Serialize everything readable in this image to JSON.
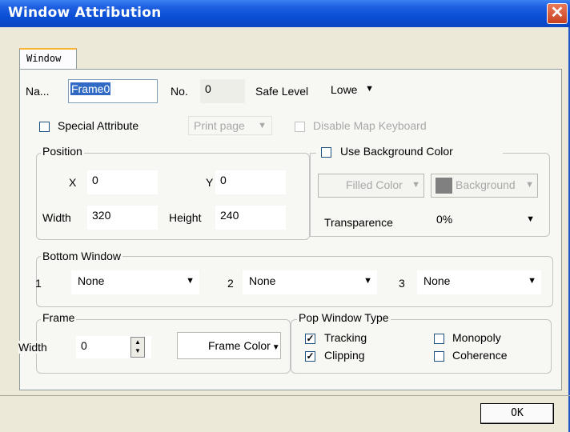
{
  "title": "Window Attribution",
  "close_glyph": "✕",
  "tab": "Window",
  "name_label": "Na...",
  "name_value": "Frame0",
  "no_label": "No.",
  "no_value": "0",
  "safe_level_label": "Safe Level",
  "safe_level_value": "Lowe",
  "special_attribute": "Special Attribute",
  "print_page": "Print page",
  "disable_map_keyboard": "Disable Map Keyboard",
  "position": {
    "title": "Position",
    "x_label": "X",
    "x_value": "0",
    "y_label": "Y",
    "y_value": "0",
    "width_label": "Width",
    "width_value": "320",
    "height_label": "Height",
    "height_value": "240"
  },
  "background": {
    "title": "Use Background Color",
    "filled_color": "Filled Color",
    "background_btn": "Background",
    "transparence_label": "Transparence",
    "transparence_value": "0%",
    "swatch_color": "#808080"
  },
  "bottom_window": {
    "title": "Bottom Window",
    "slots": [
      {
        "num": "1",
        "value": "None"
      },
      {
        "num": "2",
        "value": "None"
      },
      {
        "num": "3",
        "value": "None"
      }
    ]
  },
  "frame": {
    "title": "Frame",
    "width_label": "Width",
    "width_value": "0",
    "color_button": "Frame Color"
  },
  "pop_window": {
    "title": "Pop Window Type",
    "tracking": "Tracking",
    "tracking_checked": true,
    "clipping": "Clipping",
    "clipping_checked": true,
    "monopoly": "Monopoly",
    "monopoly_checked": false,
    "coherence": "Coherence",
    "coherence_checked": false
  },
  "ok_label": "OK",
  "colors": {
    "titlebar": "#0a4fd6",
    "dialog_bg": "#ece9d8",
    "panel_bg": "#f7f7f3",
    "selection": "#316ac5"
  }
}
